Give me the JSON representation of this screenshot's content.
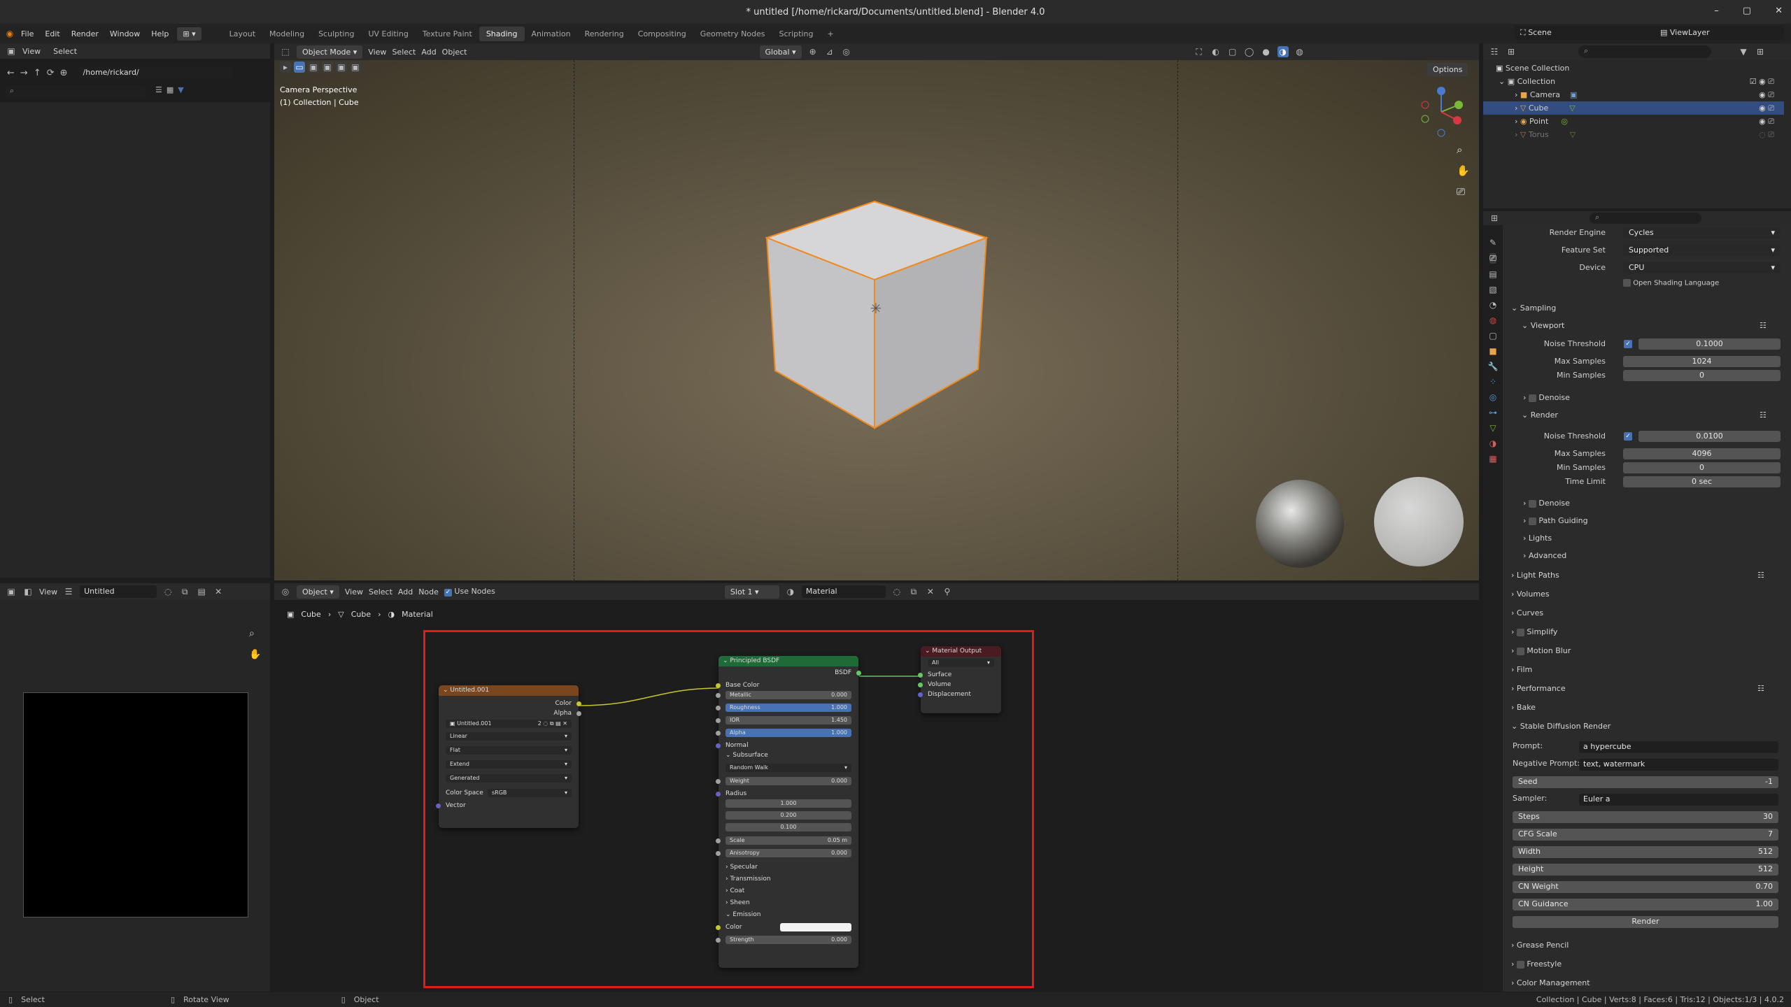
{
  "window": {
    "title": "* untitled [/home/rickard/Documents/untitled.blend] - Blender 4.0",
    "controls": [
      "–",
      "▢",
      "✕"
    ]
  },
  "menu": [
    "File",
    "Edit",
    "Render",
    "Window",
    "Help"
  ],
  "workspaces": [
    "Layout",
    "Modeling",
    "Sculpting",
    "UV Editing",
    "Texture Paint",
    "Shading",
    "Animation",
    "Rendering",
    "Compositing",
    "Geometry Nodes",
    "Scripting"
  ],
  "active_workspace": "Shading",
  "scene": {
    "scene_name": "Scene",
    "view_layer": "ViewLayer"
  },
  "filebrowser": {
    "menus": [
      "View",
      "Select"
    ],
    "path": "/home/rickard/"
  },
  "viewport": {
    "mode": "Object Mode",
    "menus": [
      "View",
      "Select",
      "Add",
      "Object"
    ],
    "transform": "Global",
    "options": "Options",
    "info_line1": "Camera Perspective",
    "info_line2": "(1) Collection | Cube"
  },
  "image_editor": {
    "view": "View",
    "image_name": "Untitled"
  },
  "node_editor": {
    "object": "Object",
    "menus": [
      "View",
      "Select",
      "Add",
      "Node"
    ],
    "use_nodes": "Use Nodes",
    "slot": "Slot 1",
    "material": "Material",
    "breadcrumb": [
      "Cube",
      "Cube",
      "Material"
    ]
  },
  "nodes": {
    "image": {
      "title": "Untitled.001",
      "out_color": "Color",
      "out_alpha": "Alpha",
      "image_name": "Untitled.001",
      "users": "2",
      "interp": "Linear",
      "proj": "Flat",
      "ext": "Extend",
      "source": "Generated",
      "cs_label": "Color Space",
      "cs_value": "sRGB",
      "vector": "Vector"
    },
    "bsdf": {
      "title": "Principled BSDF",
      "out": "BSDF",
      "base_color": "Base Color",
      "metallic": [
        "Metallic",
        "0.000"
      ],
      "roughness": [
        "Roughness",
        "1.000"
      ],
      "ior": [
        "IOR",
        "1.450"
      ],
      "alpha": [
        "Alpha",
        "1.000"
      ],
      "normal": "Normal",
      "subsurface": "Subsurface",
      "method": "Random Walk",
      "weight": [
        "Weight",
        "0.000"
      ],
      "radius": "Radius",
      "r1": "1.000",
      "r2": "0.200",
      "r3": "0.100",
      "scale": [
        "Scale",
        "0.05 m"
      ],
      "aniso": [
        "Anisotropy",
        "0.000"
      ],
      "specular": "Specular",
      "transmission": "Transmission",
      "coat": "Coat",
      "sheen": "Sheen",
      "emission": "Emission",
      "em_color": "Color",
      "strength": [
        "Strength",
        "0.000"
      ]
    },
    "output": {
      "title": "Material Output",
      "target": "All",
      "surface": "Surface",
      "volume": "Volume",
      "displacement": "Displacement"
    }
  },
  "outliner": {
    "scene_collection": "Scene Collection",
    "collection": "Collection",
    "items": [
      "Camera",
      "Cube",
      "Point",
      "Torus"
    ]
  },
  "properties": {
    "render_engine": [
      "Render Engine",
      "Cycles"
    ],
    "feature_set": [
      "Feature Set",
      "Supported"
    ],
    "device": [
      "Device",
      "CPU"
    ],
    "osl": "Open Shading Language",
    "sampling": "Sampling",
    "viewport": "Viewport",
    "vp_noise": [
      "Noise Threshold",
      "0.1000"
    ],
    "vp_max": [
      "Max Samples",
      "1024"
    ],
    "vp_min": [
      "Min Samples",
      "0"
    ],
    "denoise": "Denoise",
    "render": "Render",
    "r_noise": [
      "Noise Threshold",
      "0.0100"
    ],
    "r_max": [
      "Max Samples",
      "4096"
    ],
    "r_min": [
      "Min Samples",
      "0"
    ],
    "r_time": [
      "Time Limit",
      "0 sec"
    ],
    "denoise2": "Denoise",
    "path_guiding": "Path Guiding",
    "lights": "Lights",
    "advanced": "Advanced",
    "sections": [
      "Light Paths",
      "Volumes",
      "Curves",
      "Simplify",
      "Motion Blur",
      "Film",
      "Performance",
      "Bake"
    ],
    "sd_title": "Stable Diffusion Render",
    "prompt": [
      "Prompt:",
      "a hypercube"
    ],
    "neg_prompt": [
      "Negative Prompt:",
      "text, watermark"
    ],
    "seed": [
      "Seed",
      "-1"
    ],
    "sampler": [
      "Sampler:",
      "Euler a"
    ],
    "steps": [
      "Steps",
      "30"
    ],
    "cfg": [
      "CFG Scale",
      "7"
    ],
    "width": [
      "Width",
      "512"
    ],
    "height": [
      "Height",
      "512"
    ],
    "cn_weight": [
      "CN Weight",
      "0.70"
    ],
    "cn_guidance": [
      "CN Guidance",
      "1.00"
    ],
    "render_btn": "Render",
    "grease_pencil": "Grease Pencil",
    "freestyle": "Freestyle",
    "color_mgmt": "Color Management"
  },
  "status": {
    "select": "Select",
    "rotate": "Rotate View",
    "object": "Object",
    "info": "Collection | Cube | Verts:8 | Faces:6 | Tris:12 | Objects:1/3 | 4.0.2"
  }
}
